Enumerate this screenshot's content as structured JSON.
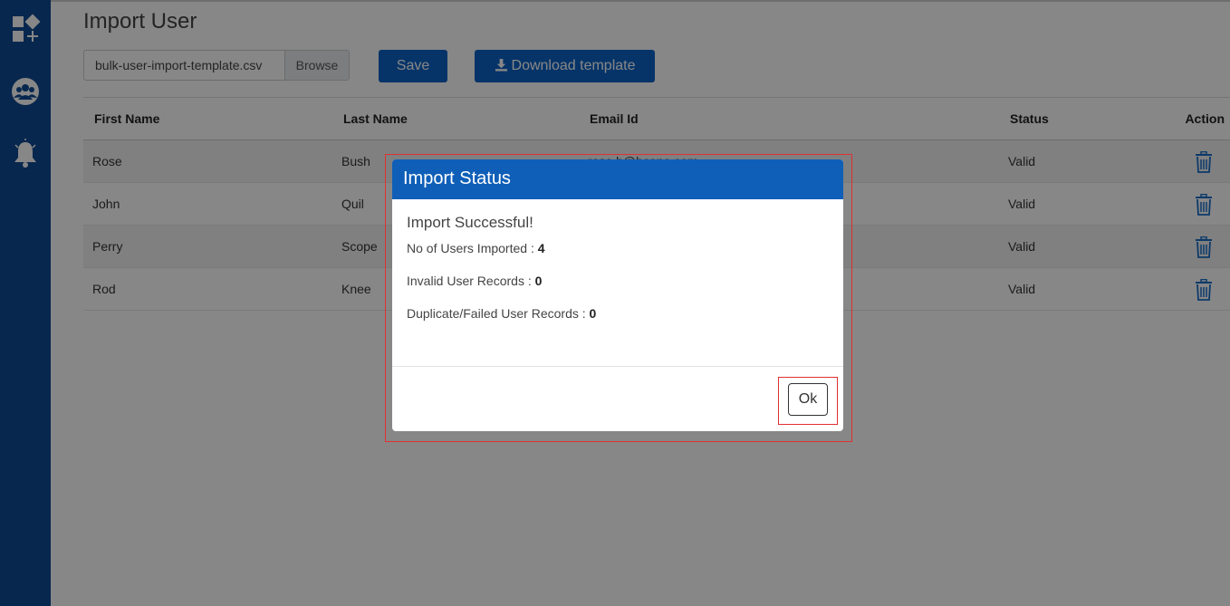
{
  "sidebar": {
    "items": [
      {
        "icon": "dashboard-add-icon"
      },
      {
        "icon": "users-group-icon"
      },
      {
        "icon": "notification-bell-icon"
      }
    ]
  },
  "page": {
    "title": "Import User",
    "file_input": {
      "value": "bulk-user-import-template.csv",
      "browse_label": "Browse"
    },
    "save_label": "Save",
    "download_label": "Download template"
  },
  "table": {
    "headers": {
      "first_name": "First Name",
      "last_name": "Last Name",
      "email": "Email Id",
      "status": "Status",
      "action": "Action"
    },
    "rows": [
      {
        "first": "Rose",
        "last": "Bush",
        "email": "rose.b@bcone.com",
        "status": "Valid"
      },
      {
        "first": "John",
        "last": "Quil",
        "email": "",
        "status": "Valid"
      },
      {
        "first": "Perry",
        "last": "Scope",
        "email": "",
        "status": "Valid"
      },
      {
        "first": "Rod",
        "last": "Knee",
        "email": "",
        "status": "Valid"
      }
    ]
  },
  "modal": {
    "title": "Import Status",
    "message": "Import Successful!",
    "stats": [
      {
        "label": "No of Users Imported : ",
        "value": "4"
      },
      {
        "label": "Invalid User Records : ",
        "value": "0"
      },
      {
        "label": "Duplicate/Failed User Records : ",
        "value": "0"
      }
    ],
    "ok_label": "Ok"
  },
  "colors": {
    "sidebar": "#0f4a93",
    "primary": "#0d62c6",
    "modal_header": "#0f5fb8",
    "annotation": "#e03030"
  }
}
